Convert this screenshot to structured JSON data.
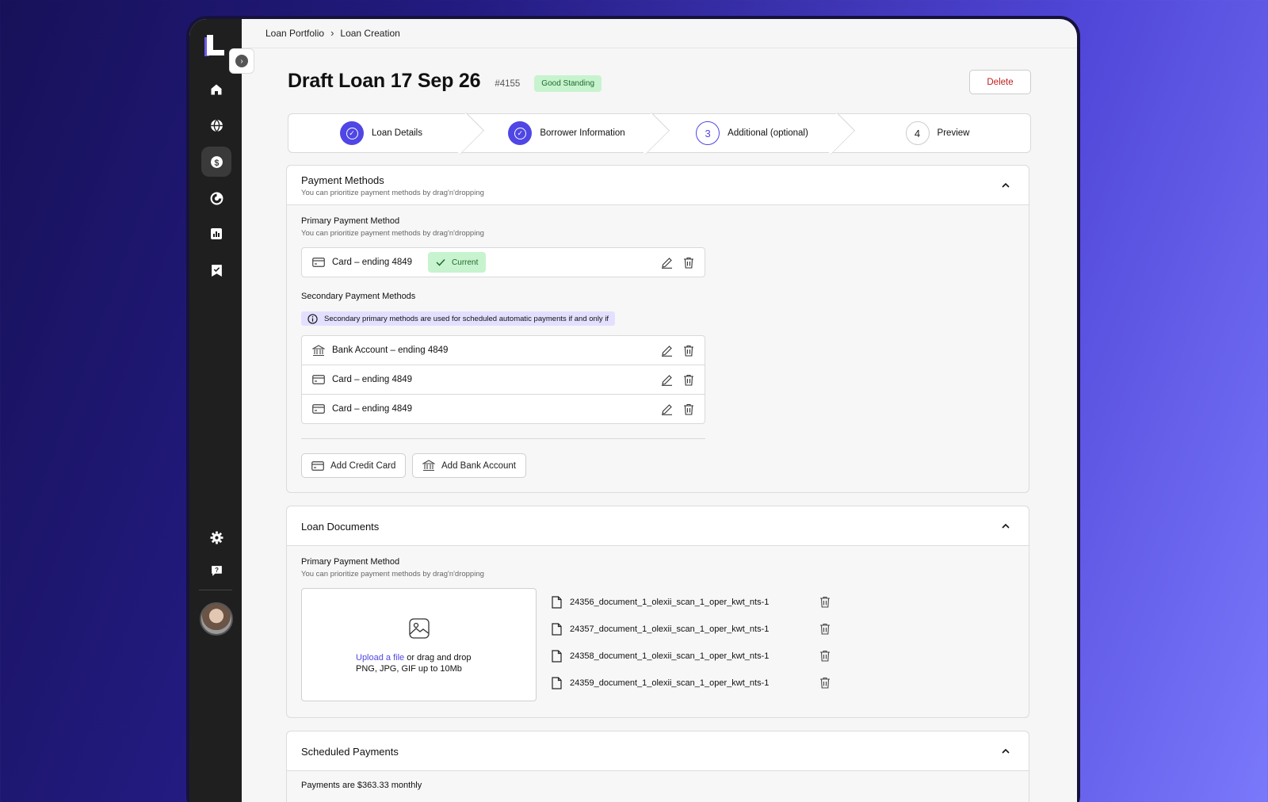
{
  "breadcrumb": {
    "items": [
      "Loan Portfolio",
      "Loan Creation"
    ]
  },
  "header": {
    "title": "Draft Loan 17 Sep 26",
    "loan_id": "#4155",
    "status_badge": "Good Standing",
    "delete_label": "Delete"
  },
  "stepper": {
    "steps": [
      {
        "label": "Loan Details",
        "state": "done",
        "number": ""
      },
      {
        "label": "Borrower Information",
        "state": "done",
        "number": ""
      },
      {
        "label": "Additional (optional)",
        "state": "current",
        "number": "3"
      },
      {
        "label": "Preview",
        "state": "todo",
        "number": "4"
      }
    ]
  },
  "payment_methods": {
    "title": "Payment Methods",
    "subtitle": "You can prioritize payment methods by drag'n'dropping",
    "primary": {
      "title": "Primary Payment Method",
      "subtitle": "You can prioritize payment methods by drag'n'dropping",
      "method": "Card – ending 4849",
      "badge": "Current"
    },
    "secondary": {
      "title": "Secondary Payment Methods",
      "info": "Secondary primary methods are used for scheduled automatic payments if and only if",
      "methods": [
        {
          "label": "Bank Account – ending 4849",
          "icon": "bank-icon"
        },
        {
          "label": "Card – ending 4849",
          "icon": "card-icon"
        },
        {
          "label": "Card – ending 4849",
          "icon": "card-icon"
        }
      ]
    },
    "add_card_label": "Add Credit Card",
    "add_bank_label": "Add Bank Account"
  },
  "loan_documents": {
    "title": "Loan Documents",
    "section_title": "Primary Payment Method",
    "section_subtitle": "You can prioritize payment methods by drag'n'dropping",
    "upload_link": "Upload a file",
    "upload_rest": " or drag and drop",
    "upload_hint": "PNG, JPG, GIF up to 10Mb",
    "files": [
      "24356_document_1_olexii_scan_1_oper_kwt_nts-1",
      "24357_document_1_olexii_scan_1_oper_kwt_nts-1",
      "24358_document_1_olexii_scan_1_oper_kwt_nts-1",
      "24359_document_1_olexii_scan_1_oper_kwt_nts-1"
    ]
  },
  "scheduled_payments": {
    "title": "Scheduled Payments",
    "summary": "Payments are $363.33 monthly"
  },
  "sidebar": {
    "items": [
      {
        "icon": "home-icon",
        "active": false
      },
      {
        "icon": "globe-icon",
        "active": false
      },
      {
        "icon": "dollar-icon",
        "active": true
      },
      {
        "icon": "chart-pie-icon",
        "active": false
      },
      {
        "icon": "bar-chart-icon",
        "active": false
      },
      {
        "icon": "bookmark-check-icon",
        "active": false
      }
    ],
    "bottom": [
      "settings-icon",
      "help-chat-icon"
    ]
  },
  "colors": {
    "accent": "#4f46e5",
    "success_bg": "#c8f3cf",
    "danger": "#c01d1d",
    "sidebar_bg": "#1f1f1f"
  }
}
